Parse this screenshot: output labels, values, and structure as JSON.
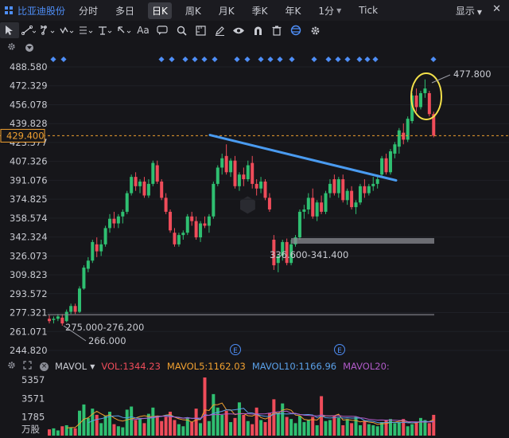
{
  "header": {
    "stock_name": "比亚迪股份",
    "timeframes": [
      "分时",
      "多日",
      "日K",
      "周K",
      "月K",
      "季K",
      "年K",
      "1分",
      "Tick"
    ],
    "active_timeframe": "日K",
    "display_label": "显示",
    "close_glyph": "✕"
  },
  "toolbar": {
    "icons": [
      "cursor-icon",
      "line-tool-icon",
      "multi-line-icon",
      "wave-tool-icon",
      "fib-tool-icon",
      "level-tool-icon",
      "arrow-tool-icon",
      "text-tool-icon",
      "comment-icon",
      "measure-icon",
      "ruler-icon",
      "pencil-icon",
      "eye-icon",
      "magnet-icon",
      "trash-icon",
      "sync-icon",
      "gear-icon"
    ],
    "text_tool_label": "Aa"
  },
  "price_axis": {
    "ticks": [
      "488.580",
      "472.329",
      "456.078",
      "439.828",
      "423.577",
      "407.326",
      "391.076",
      "374.825",
      "358.574",
      "342.324",
      "326.073",
      "309.823",
      "293.572",
      "277.321",
      "261.071",
      "244.820"
    ],
    "current_price": "429.400"
  },
  "annotations": {
    "high_label": "477.800",
    "low_label": "266.000",
    "support_low_label": "275.000-276.200",
    "support_mid_label": "336.600-341.400",
    "event_marker": "E"
  },
  "colors": {
    "up": "#2fbf71",
    "down": "#ef4c5a",
    "accent": "#4e8ef7",
    "trendline": "#4a9bf0",
    "circle": "#f3e04a",
    "current_price": "#f0a030",
    "ma5": "#f0a030",
    "ma10": "#5aa0e8",
    "ma20": "#b05ac8"
  },
  "chart_data": {
    "type": "candlestick",
    "ylim": [
      244.82,
      488.58
    ],
    "candles": [
      {
        "o": 272,
        "h": 275,
        "l": 268,
        "c": 270
      },
      {
        "o": 271,
        "h": 274,
        "l": 268,
        "c": 272
      },
      {
        "o": 272,
        "h": 276,
        "l": 270,
        "c": 274
      },
      {
        "o": 273,
        "h": 276,
        "l": 266,
        "c": 268
      },
      {
        "o": 270,
        "h": 280,
        "l": 269,
        "c": 278
      },
      {
        "o": 278,
        "h": 285,
        "l": 276,
        "c": 283
      },
      {
        "o": 283,
        "h": 285,
        "l": 276,
        "c": 278
      },
      {
        "o": 278,
        "h": 300,
        "l": 277,
        "c": 298
      },
      {
        "o": 298,
        "h": 318,
        "l": 297,
        "c": 316
      },
      {
        "o": 315,
        "h": 325,
        "l": 312,
        "c": 322
      },
      {
        "o": 322,
        "h": 340,
        "l": 320,
        "c": 338
      },
      {
        "o": 336,
        "h": 342,
        "l": 325,
        "c": 330
      },
      {
        "o": 330,
        "h": 340,
        "l": 326,
        "c": 336
      },
      {
        "o": 336,
        "h": 352,
        "l": 334,
        "c": 350
      },
      {
        "o": 350,
        "h": 362,
        "l": 346,
        "c": 358
      },
      {
        "o": 358,
        "h": 364,
        "l": 350,
        "c": 354
      },
      {
        "o": 354,
        "h": 362,
        "l": 350,
        "c": 360
      },
      {
        "o": 360,
        "h": 366,
        "l": 354,
        "c": 364
      },
      {
        "o": 364,
        "h": 382,
        "l": 362,
        "c": 380
      },
      {
        "o": 380,
        "h": 396,
        "l": 378,
        "c": 394
      },
      {
        "o": 394,
        "h": 398,
        "l": 382,
        "c": 386
      },
      {
        "o": 386,
        "h": 392,
        "l": 380,
        "c": 390
      },
      {
        "o": 390,
        "h": 394,
        "l": 376,
        "c": 378
      },
      {
        "o": 378,
        "h": 392,
        "l": 376,
        "c": 388
      },
      {
        "o": 388,
        "h": 408,
        "l": 386,
        "c": 406
      },
      {
        "o": 404,
        "h": 408,
        "l": 388,
        "c": 390
      },
      {
        "o": 390,
        "h": 392,
        "l": 374,
        "c": 376
      },
      {
        "o": 376,
        "h": 380,
        "l": 362,
        "c": 364
      },
      {
        "o": 364,
        "h": 366,
        "l": 346,
        "c": 348
      },
      {
        "o": 346,
        "h": 350,
        "l": 334,
        "c": 336
      },
      {
        "o": 336,
        "h": 346,
        "l": 334,
        "c": 344
      },
      {
        "o": 344,
        "h": 348,
        "l": 340,
        "c": 346
      },
      {
        "o": 346,
        "h": 362,
        "l": 344,
        "c": 360
      },
      {
        "o": 360,
        "h": 364,
        "l": 352,
        "c": 356
      },
      {
        "o": 356,
        "h": 360,
        "l": 340,
        "c": 342
      },
      {
        "o": 342,
        "h": 356,
        "l": 338,
        "c": 354
      },
      {
        "o": 354,
        "h": 360,
        "l": 350,
        "c": 352
      },
      {
        "o": 352,
        "h": 362,
        "l": 346,
        "c": 360
      },
      {
        "o": 360,
        "h": 390,
        "l": 358,
        "c": 388
      },
      {
        "o": 388,
        "h": 404,
        "l": 386,
        "c": 402
      },
      {
        "o": 402,
        "h": 414,
        "l": 396,
        "c": 410
      },
      {
        "o": 412,
        "h": 422,
        "l": 396,
        "c": 398
      },
      {
        "o": 398,
        "h": 410,
        "l": 394,
        "c": 408
      },
      {
        "o": 408,
        "h": 412,
        "l": 384,
        "c": 386
      },
      {
        "o": 386,
        "h": 398,
        "l": 382,
        "c": 396
      },
      {
        "o": 396,
        "h": 402,
        "l": 386,
        "c": 392
      },
      {
        "o": 392,
        "h": 408,
        "l": 390,
        "c": 404
      },
      {
        "o": 406,
        "h": 412,
        "l": 384,
        "c": 388
      },
      {
        "o": 388,
        "h": 392,
        "l": 378,
        "c": 384
      },
      {
        "o": 384,
        "h": 394,
        "l": 380,
        "c": 390
      },
      {
        "o": 390,
        "h": 392,
        "l": 374,
        "c": 376
      },
      {
        "o": 376,
        "h": 380,
        "l": 364,
        "c": 366
      },
      {
        "o": 340,
        "h": 344,
        "l": 314,
        "c": 318
      },
      {
        "o": 320,
        "h": 328,
        "l": 312,
        "c": 326
      },
      {
        "o": 326,
        "h": 340,
        "l": 322,
        "c": 338
      },
      {
        "o": 338,
        "h": 341,
        "l": 318,
        "c": 320
      },
      {
        "o": 320,
        "h": 340,
        "l": 318,
        "c": 336
      },
      {
        "o": 336,
        "h": 344,
        "l": 334,
        "c": 342
      },
      {
        "o": 342,
        "h": 366,
        "l": 340,
        "c": 364
      },
      {
        "o": 364,
        "h": 370,
        "l": 358,
        "c": 366
      },
      {
        "o": 366,
        "h": 380,
        "l": 362,
        "c": 376
      },
      {
        "o": 376,
        "h": 384,
        "l": 358,
        "c": 360
      },
      {
        "o": 360,
        "h": 374,
        "l": 356,
        "c": 372
      },
      {
        "o": 372,
        "h": 378,
        "l": 362,
        "c": 364
      },
      {
        "o": 364,
        "h": 382,
        "l": 362,
        "c": 380
      },
      {
        "o": 380,
        "h": 392,
        "l": 376,
        "c": 388
      },
      {
        "o": 392,
        "h": 396,
        "l": 378,
        "c": 380
      },
      {
        "o": 380,
        "h": 394,
        "l": 376,
        "c": 392
      },
      {
        "o": 392,
        "h": 396,
        "l": 372,
        "c": 374
      },
      {
        "o": 374,
        "h": 384,
        "l": 370,
        "c": 382
      },
      {
        "o": 382,
        "h": 386,
        "l": 366,
        "c": 368
      },
      {
        "o": 368,
        "h": 374,
        "l": 362,
        "c": 372
      },
      {
        "o": 372,
        "h": 388,
        "l": 370,
        "c": 386
      },
      {
        "o": 386,
        "h": 392,
        "l": 376,
        "c": 380
      },
      {
        "o": 380,
        "h": 388,
        "l": 378,
        "c": 386
      },
      {
        "o": 386,
        "h": 394,
        "l": 382,
        "c": 388
      },
      {
        "o": 388,
        "h": 396,
        "l": 384,
        "c": 392
      },
      {
        "o": 396,
        "h": 412,
        "l": 394,
        "c": 410
      },
      {
        "o": 410,
        "h": 414,
        "l": 396,
        "c": 398
      },
      {
        "o": 398,
        "h": 418,
        "l": 396,
        "c": 416
      },
      {
        "o": 414,
        "h": 424,
        "l": 410,
        "c": 422
      },
      {
        "o": 420,
        "h": 436,
        "l": 414,
        "c": 434
      },
      {
        "o": 432,
        "h": 440,
        "l": 422,
        "c": 426
      },
      {
        "o": 426,
        "h": 446,
        "l": 424,
        "c": 444
      },
      {
        "o": 442,
        "h": 466,
        "l": 440,
        "c": 464
      },
      {
        "o": 464,
        "h": 470,
        "l": 450,
        "c": 454
      },
      {
        "o": 454,
        "h": 468,
        "l": 452,
        "c": 466
      },
      {
        "o": 466,
        "h": 477.8,
        "l": 462,
        "c": 470
      },
      {
        "o": 466,
        "h": 468,
        "l": 446,
        "c": 448
      },
      {
        "o": 448,
        "h": 450,
        "l": 428,
        "c": 429.4
      }
    ],
    "volume": [
      600,
      700,
      500,
      900,
      1000,
      800,
      700,
      2400,
      3000,
      1700,
      2600,
      2000,
      1200,
      1900,
      2300,
      1100,
      900,
      800,
      2500,
      2800,
      1500,
      1600,
      1200,
      2100,
      2700,
      1900,
      1400,
      1800,
      2300,
      1500,
      1100,
      900,
      1700,
      1300,
      2600,
      1200,
      5600,
      1400,
      4000,
      2700,
      2000,
      2400,
      1300,
      1700,
      3200,
      2000,
      1400,
      1100,
      2700,
      1500,
      1300,
      2200,
      3500,
      2200,
      3100,
      1800,
      1600,
      1200,
      1900,
      1300,
      1500,
      1800,
      1000,
      3800,
      1400,
      1500,
      1900,
      1700,
      1000,
      1600,
      1200,
      1800,
      1000,
      1400,
      1100,
      1000,
      900,
      1300,
      1500,
      1600,
      1200,
      1300,
      1600,
      900,
      1100,
      1300,
      1700,
      1500,
      1200,
      2000
    ],
    "volume_ticks": [
      "5357",
      "3571",
      "1785"
    ],
    "volume_unit": "万股",
    "vol_legend": {
      "name": "MAVOL",
      "vol": "VOL:1344.23",
      "ma5": "MAVOL5:1162.03",
      "ma10": "MAVOL10:1166.96",
      "ma20": "MAVOL20:"
    }
  }
}
